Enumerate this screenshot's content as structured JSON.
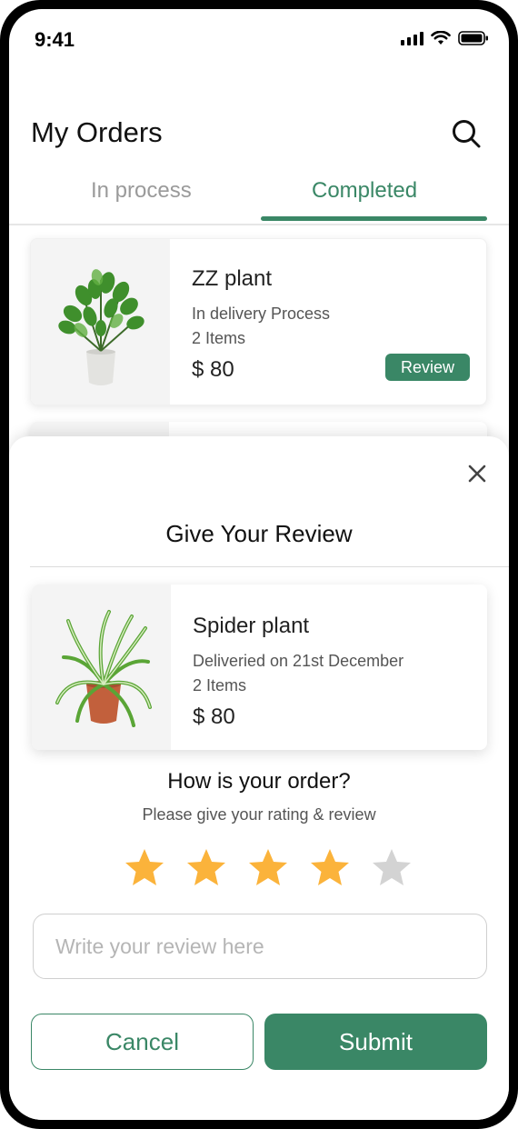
{
  "status_bar": {
    "time": "9:41"
  },
  "header": {
    "title": "My Orders"
  },
  "tabs": [
    {
      "label": "In process",
      "active": false
    },
    {
      "label": "Completed",
      "active": true
    }
  ],
  "order": {
    "name": "ZZ plant",
    "status": "In delivery Process",
    "items": "2 Items",
    "price": "$ 80",
    "review_label": "Review"
  },
  "review_sheet": {
    "title": "Give Your Review",
    "product": {
      "name": "Spider plant",
      "delivered": "Deliveried on 21st December",
      "items": "2 Items",
      "price": "$ 80"
    },
    "question": "How is your order?",
    "hint": "Please give your rating & review",
    "rating": 4,
    "rating_max": 5,
    "input_placeholder": "Write your review here",
    "cancel_label": "Cancel",
    "submit_label": "Submit"
  },
  "colors": {
    "accent": "#3a8766",
    "star_filled": "#fbb33b",
    "star_empty": "#d3d3d3"
  }
}
